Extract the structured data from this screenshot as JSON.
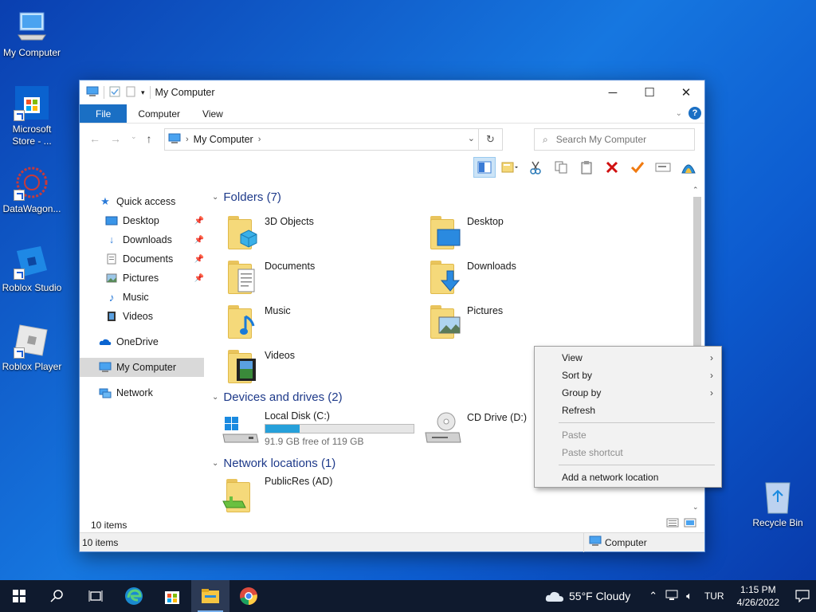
{
  "desktop": {
    "icons": [
      {
        "label": "My Computer"
      },
      {
        "label": "Microsoft Store - ..."
      },
      {
        "label": "DataWagon..."
      },
      {
        "label": "Roblox Studio"
      },
      {
        "label": "Roblox Player"
      }
    ],
    "recycle_bin": "Recycle Bin"
  },
  "window": {
    "title": "My Computer",
    "tabs": [
      "File",
      "Computer",
      "View"
    ],
    "address": {
      "crumb": "My Computer"
    },
    "search": {
      "placeholder": "Search My Computer"
    },
    "nav": {
      "quick_access": "Quick access",
      "items": [
        "Desktop",
        "Downloads",
        "Documents",
        "Pictures",
        "Music",
        "Videos"
      ],
      "onedrive": "OneDrive",
      "my_computer": "My Computer",
      "network": "Network"
    },
    "groups": {
      "folders": "Folders (7)",
      "devices": "Devices and drives (2)",
      "network": "Network locations (1)"
    },
    "folders": [
      "3D Objects",
      "Desktop",
      "Documents",
      "Downloads",
      "Music",
      "Pictures",
      "Videos"
    ],
    "drives": {
      "c": {
        "name": "Local Disk (C:)",
        "free": "91.9 GB free of 119 GB",
        "used_fraction": 0.23
      },
      "d": {
        "name": "CD Drive (D:)"
      }
    },
    "network_location": "PublicRes (AD)",
    "items_count": "10 items",
    "status_items": "10 items",
    "status_location": "Computer"
  },
  "context_menu": {
    "view": "View",
    "sort_by": "Sort by",
    "group_by": "Group by",
    "refresh": "Refresh",
    "paste": "Paste",
    "paste_shortcut": "Paste shortcut",
    "add_network": "Add a network location"
  },
  "taskbar": {
    "weather": "55°F  Cloudy",
    "lang": "TUR",
    "time": "1:15 PM",
    "date": "4/26/2022"
  }
}
